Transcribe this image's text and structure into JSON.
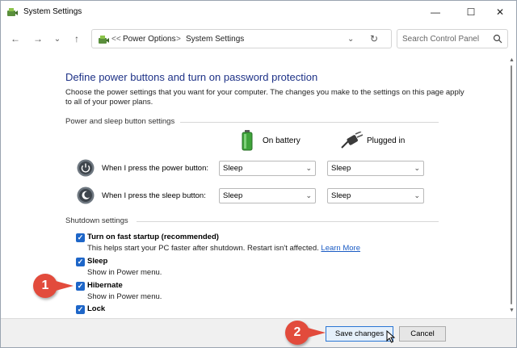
{
  "window": {
    "title": "System Settings",
    "controls": {
      "minimize": "—",
      "maximize": "☐",
      "close": "✕"
    }
  },
  "nav": {
    "back": "←",
    "forward": "→",
    "recent": "⌄",
    "up": "↑",
    "breadcrumb_sep": "<<",
    "crumbs": [
      "Power Options",
      "System Settings"
    ],
    "crumb_arrow": ">",
    "dropdown": "⌄",
    "refresh": "↻",
    "search_placeholder": "Search Control Panel"
  },
  "content": {
    "heading": "Define power buttons and turn on password protection",
    "description": "Choose the power settings that you want for your computer. The changes you make to the settings on this page apply to all of your power plans.",
    "power_section": "Power and sleep button settings",
    "col_battery": "On battery",
    "col_plugged": "Plugged in",
    "rows": [
      {
        "label": "When I press the power button:",
        "battery": "Sleep",
        "plugged": "Sleep"
      },
      {
        "label": "When I press the sleep button:",
        "battery": "Sleep",
        "plugged": "Sleep"
      }
    ],
    "shutdown_section": "Shutdown settings",
    "options": [
      {
        "label": "Turn on fast startup (recommended)",
        "checked": true,
        "desc": "This helps start your PC faster after shutdown. Restart isn't affected.",
        "link": "Learn More"
      },
      {
        "label": "Sleep",
        "checked": true,
        "desc": "Show in Power menu."
      },
      {
        "label": "Hibernate",
        "checked": true,
        "desc": "Show in Power menu."
      },
      {
        "label": "Lock",
        "checked": true
      }
    ]
  },
  "footer": {
    "save": "Save changes",
    "cancel": "Cancel"
  },
  "callouts": [
    "1",
    "2"
  ],
  "colors": {
    "heading": "#1e3287",
    "checkbox": "#1e66c8",
    "link": "#1a5bc4",
    "callout": "#e24b3c"
  },
  "icons": {
    "app": "power-options-icon",
    "battery": "battery-icon",
    "plug": "power-plug-icon",
    "power_button": "power-button-icon",
    "sleep_button": "sleep-button-icon",
    "search": "search-icon",
    "cursor": "mouse-pointer-icon"
  }
}
